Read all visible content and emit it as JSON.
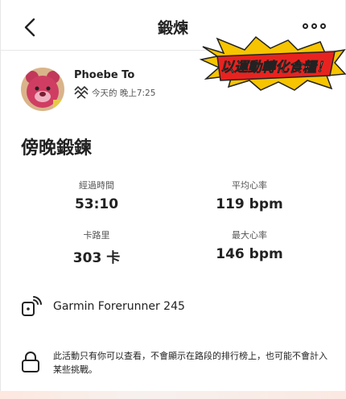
{
  "header": {
    "title": "鍛煉",
    "back_icon": "chevron-left-icon",
    "more_icon": "more-dots-icon"
  },
  "sticker": {
    "text": "以運動轉化食糧！",
    "colors": {
      "fill": "#e8231f",
      "burst": "#f6c400",
      "text": "#ffffff"
    }
  },
  "athlete": {
    "name": "Phoebe To",
    "activity_icon": "workout-wave-icon",
    "timestamp": "今天的 晚上7:25"
  },
  "activity": {
    "title": "傍晚鍛鍊"
  },
  "stats": [
    {
      "label": "經過時間",
      "value": "53:10"
    },
    {
      "label": "平均心率",
      "value": "119 bpm"
    },
    {
      "label": "卡路里",
      "value": "303 卡"
    },
    {
      "label": "最大心率",
      "value": "146 bpm"
    }
  ],
  "device": {
    "icon": "watch-sync-icon",
    "name": "Garmin Forerunner 245"
  },
  "privacy": {
    "icon": "lock-icon",
    "text": "此活動只有你可以查看，不會顯示在路段的排行榜上，也可能不會計入某些挑戰。"
  }
}
